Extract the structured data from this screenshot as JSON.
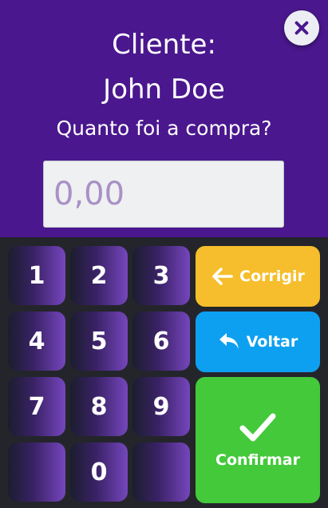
{
  "header": {
    "title": "Cliente:",
    "customer_name": "John Doe",
    "question": "Quanto foi a compra?",
    "amount_placeholder": "0,00",
    "close_icon": "close-icon"
  },
  "keypad": {
    "k1": "1",
    "k2": "2",
    "k3": "3",
    "k4": "4",
    "k5": "5",
    "k6": "6",
    "k7": "7",
    "k8": "8",
    "k9": "9",
    "k0": "0"
  },
  "actions": {
    "corrigir_label": "Corrigir",
    "voltar_label": "Voltar",
    "confirmar_label": "Confirmar"
  },
  "colors": {
    "header_bg": "#4a178e",
    "corrigir": "#f6be2c",
    "voltar": "#0ea0f0",
    "confirmar": "#43c93a"
  }
}
